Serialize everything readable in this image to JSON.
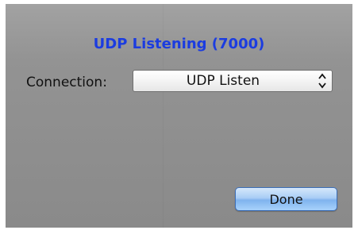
{
  "dialog": {
    "title": "UDP Listening (7000)",
    "connection_label": "Connection:",
    "connection_value": "UDP Listen",
    "done_label": "Done"
  },
  "colors": {
    "title": "#1b3ce0",
    "panel": "#8d8d8d",
    "button": "#a9cdf5"
  },
  "icons": {
    "popup_arrows": "up-down-chevron-icon"
  }
}
